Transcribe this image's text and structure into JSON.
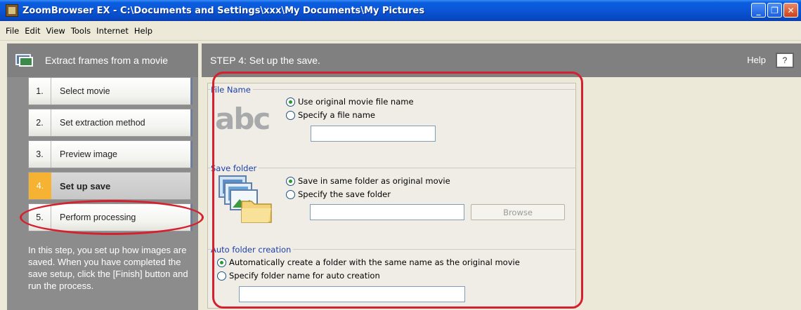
{
  "window": {
    "title": "ZoomBrowser EX  -  C:\\Documents and Settings\\xxx\\My Documents\\My Pictures",
    "controls": {
      "minimize": "_",
      "maximize": "❐",
      "close": "✕"
    }
  },
  "menu": [
    "File",
    "Edit",
    "View",
    "Tools",
    "Internet",
    "Help"
  ],
  "sidebar": {
    "title": "Extract frames from a movie",
    "steps": [
      {
        "num": "1.",
        "label": "Select movie"
      },
      {
        "num": "2.",
        "label": "Set extraction method"
      },
      {
        "num": "3.",
        "label": "Preview image"
      },
      {
        "num": "4.",
        "label": "Set up save"
      },
      {
        "num": "5.",
        "label": "Perform processing"
      }
    ],
    "description": "In this step, you set up how images are saved. When you have completed the save setup, click the [Finish] button and run the process."
  },
  "main": {
    "step_title": "STEP 4: Set up the save.",
    "help_label": "Help",
    "help_button": "?",
    "file_name": {
      "title": "File Name",
      "icon_text": "abc",
      "option_original": "Use original movie file name",
      "option_specify": "Specify a file name",
      "input_value": "",
      "selected": "original"
    },
    "save_folder": {
      "title": "Save folder",
      "option_same": "Save in same folder as original movie",
      "option_specify": "Specify the save folder",
      "input_value": "",
      "browse": "Browse",
      "selected": "same"
    },
    "auto_folder": {
      "title": "Auto folder creation",
      "option_auto": "Automatically create a folder with the same name as the original movie",
      "option_specify": "Specify folder name for auto creation",
      "input_value": "",
      "selected": "auto"
    }
  },
  "colors": {
    "titlebar": "#0A55D6",
    "panel_header": "#808080",
    "active_step": "#F6B333",
    "section_title": "#1a3fa8",
    "highlight": "#D5212F"
  }
}
